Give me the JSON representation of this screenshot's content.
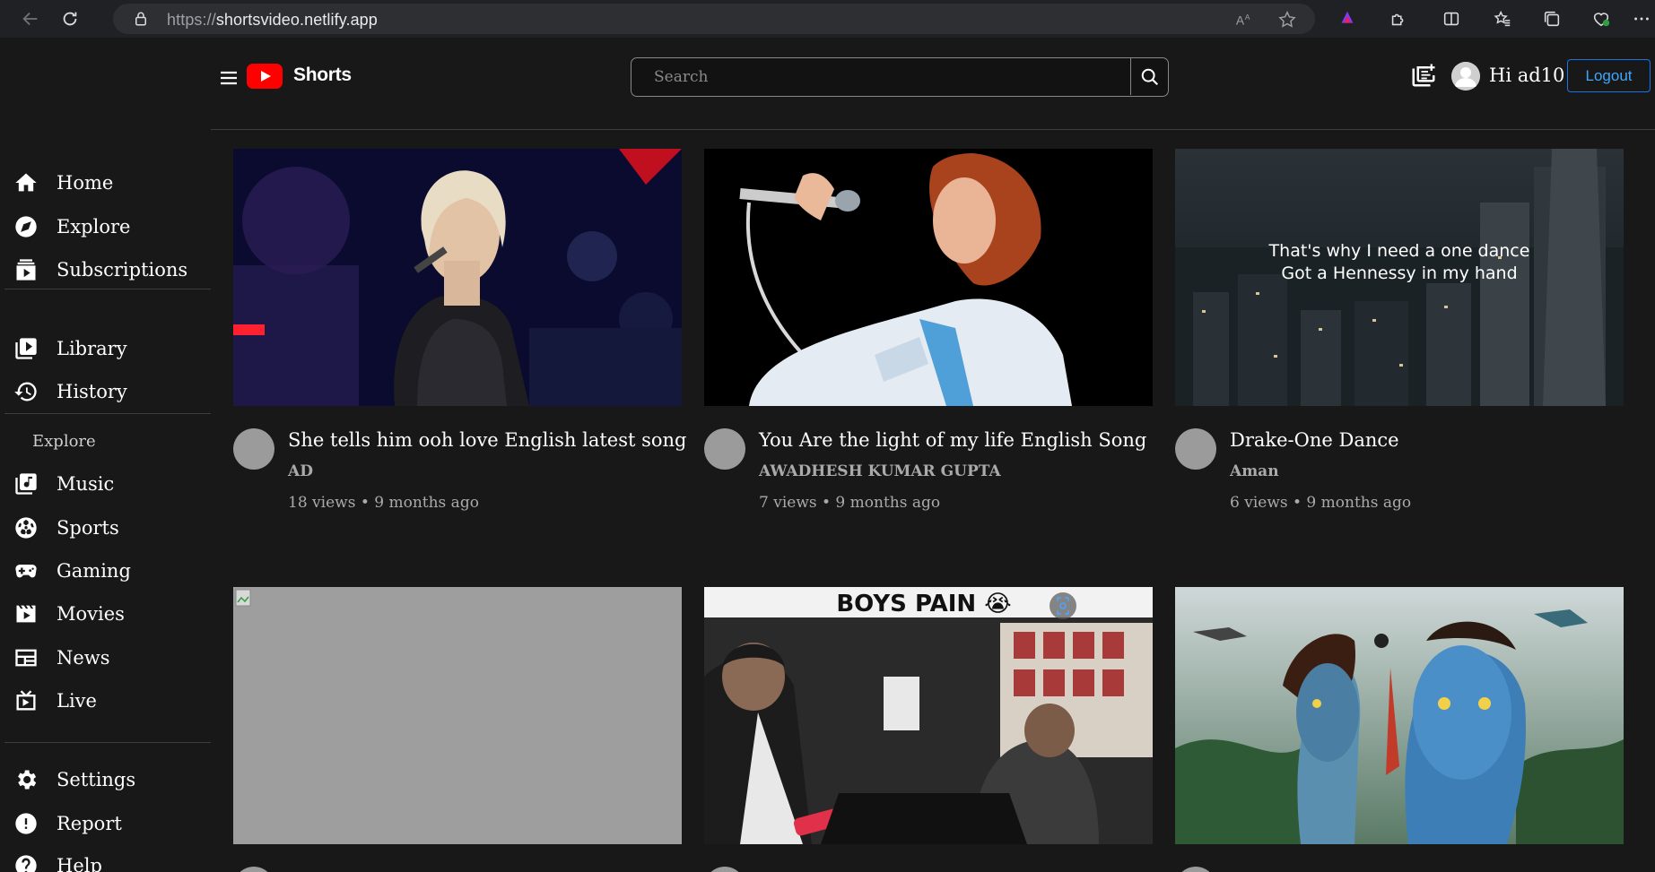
{
  "browser": {
    "url_protocol": "https://",
    "url_host": "shortsvideo.netlify.app"
  },
  "header": {
    "brand": "Shorts",
    "search_placeholder": "Search",
    "greeting": "Hi ad10",
    "logout_label": "Logout"
  },
  "sidebar": {
    "items": [
      {
        "label": "Home",
        "icon": "home-icon"
      },
      {
        "label": "Explore",
        "icon": "compass-icon"
      },
      {
        "label": "Subscriptions",
        "icon": "subscriptions-icon"
      },
      {
        "label": "Library",
        "icon": "library-icon"
      },
      {
        "label": "History",
        "icon": "history-icon"
      }
    ],
    "explore_heading": "Explore",
    "explore_items": [
      {
        "label": "Music",
        "icon": "music-icon"
      },
      {
        "label": "Sports",
        "icon": "sports-icon"
      },
      {
        "label": "Gaming",
        "icon": "gaming-icon"
      },
      {
        "label": "Movies",
        "icon": "movies-icon"
      },
      {
        "label": "News",
        "icon": "news-icon"
      },
      {
        "label": "Live",
        "icon": "live-icon"
      }
    ],
    "bottom_items": [
      {
        "label": "Settings",
        "icon": "gear-icon"
      },
      {
        "label": "Report",
        "icon": "report-icon"
      },
      {
        "label": "Help",
        "icon": "help-icon"
      }
    ]
  },
  "videos": [
    {
      "title": "She tells him ooh love English latest song",
      "channel": "AD",
      "stats": "18 views • 9 months ago"
    },
    {
      "title": "You Are the light of my life English Song",
      "channel": "AWADHESH KUMAR GUPTA",
      "stats": "7 views • 9 months ago"
    },
    {
      "title": "Drake-One Dance",
      "channel": "Aman",
      "stats": "6 views • 9 months ago",
      "caption_1": "That's why I need a one dance",
      "caption_2": "Got a Hennessy in my hand"
    },
    {
      "title": "",
      "channel": "",
      "stats": ""
    },
    {
      "title": "",
      "channel": "",
      "stats": "",
      "caption": "BOYS PAIN 😭"
    },
    {
      "title": "",
      "channel": "",
      "stats": ""
    }
  ],
  "colors": {
    "background": "#181818",
    "brand_red": "#ff0000",
    "link_blue": "#3ea6ff"
  }
}
